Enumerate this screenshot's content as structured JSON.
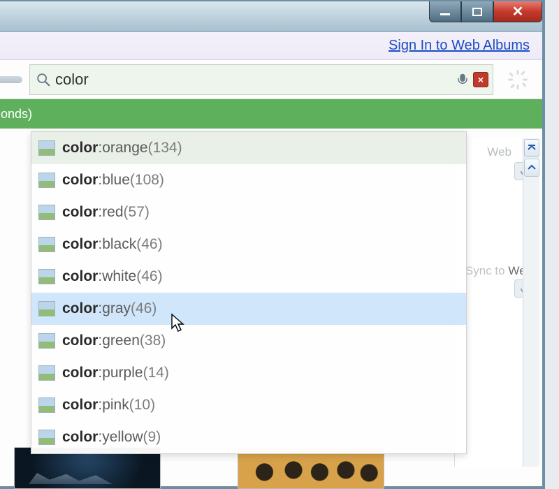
{
  "window": {
    "controls": {
      "min": "minimize",
      "max": "maximize",
      "close": "close"
    }
  },
  "linkbar": {
    "signin_label": "Sign In to Web Albums"
  },
  "search": {
    "value": "color",
    "placeholder": ""
  },
  "statusbar": {
    "left_fragment": "onds)"
  },
  "right": {
    "web_label_top": "Web",
    "sync_label": "Sync to",
    "sync_web": "Web"
  },
  "suggestions": [
    {
      "prefix": "color",
      "value": "orange",
      "count": 134,
      "state": "selected-top"
    },
    {
      "prefix": "color",
      "value": "blue",
      "count": 108,
      "state": ""
    },
    {
      "prefix": "color",
      "value": "red",
      "count": 57,
      "state": ""
    },
    {
      "prefix": "color",
      "value": "black",
      "count": 46,
      "state": ""
    },
    {
      "prefix": "color",
      "value": "white",
      "count": 46,
      "state": ""
    },
    {
      "prefix": "color",
      "value": "gray",
      "count": 46,
      "state": "highlight"
    },
    {
      "prefix": "color",
      "value": "green",
      "count": 38,
      "state": ""
    },
    {
      "prefix": "color",
      "value": "purple",
      "count": 14,
      "state": ""
    },
    {
      "prefix": "color",
      "value": "pink",
      "count": 10,
      "state": ""
    },
    {
      "prefix": "color",
      "value": "yellow",
      "count": 9,
      "state": ""
    }
  ]
}
